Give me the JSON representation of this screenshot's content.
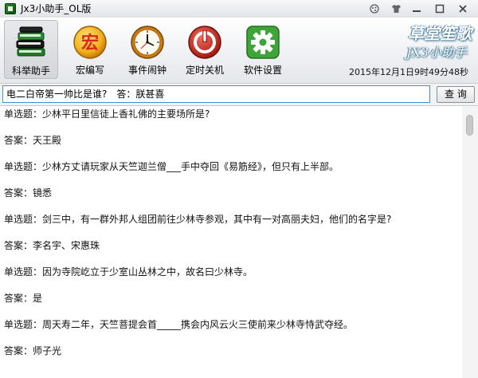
{
  "window": {
    "title": "Jx3小助手_OL版"
  },
  "toolbar": {
    "tools": [
      {
        "label": "科举助手",
        "icon": "books-icon",
        "active": true
      },
      {
        "label": "宏编写",
        "icon": "macro-seal-icon",
        "active": false,
        "glyph": "宏"
      },
      {
        "label": "事件闹钟",
        "icon": "clock-icon",
        "active": false
      },
      {
        "label": "定时关机",
        "icon": "power-icon",
        "active": false
      },
      {
        "label": "软件设置",
        "icon": "gear-icon",
        "active": false
      }
    ],
    "brand_title": "草堂笙歌",
    "brand_subtitle": "JX3小助手",
    "datetime": "2015年12月1日9时49分48秒"
  },
  "search": {
    "value": "电二白帝第一帅比是谁?　答：朕甚喜",
    "button_label": "查 询"
  },
  "results": [
    "单选题：少林平日里信徒上香礼佛的主要场所是?",
    "答案：天王殿",
    "单选题：少林方丈请玩家从天竺迦兰僧___手中夺回《易筋经》，但只有上半部。",
    "答案：镜悉",
    "单选题：剑三中，有一群外邦人组团前往少林寺参观，其中有一对高丽夫妇，他们的名字是?",
    "答案：李名宇、宋惠珠",
    "单选题：因为寺院屹立于少室山丛林之中，故名曰少林寺。",
    "答案：是",
    "单选题：周天寿二年，天竺菩提会首_____携会内风云火三使前来少林寺恃武夺经。",
    "答案：师子光"
  ],
  "colors": {
    "input_border": "#3f8fd5",
    "seal_red": "#d92a1a",
    "power_red": "#c9271e",
    "gear_green": "#3fa53a"
  }
}
